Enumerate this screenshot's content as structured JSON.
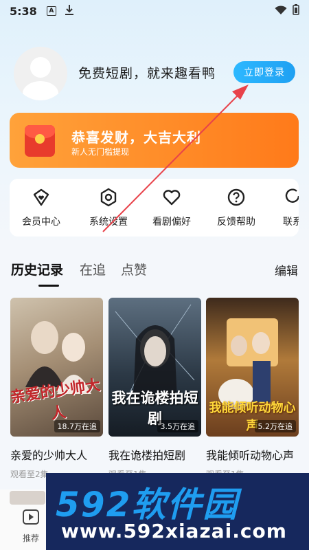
{
  "status_bar": {
    "time": "5:38",
    "a_icon": "A"
  },
  "profile": {
    "headline": "免费短剧，就来趣看鸭",
    "login_label": "立即登录"
  },
  "banner": {
    "title": "恭喜发财，大吉大利",
    "subtitle": "新人无门槛提现"
  },
  "menu": [
    {
      "label": "会员中心",
      "icon": "heart-shield-icon"
    },
    {
      "label": "系统设置",
      "icon": "hexagon-gear-icon"
    },
    {
      "label": "看剧偏好",
      "icon": "heart-icon"
    },
    {
      "label": "反馈帮助",
      "icon": "question-icon"
    },
    {
      "label": "联系",
      "icon": "contact-icon"
    }
  ],
  "tabs": {
    "history": "历史记录",
    "following": "在追",
    "liked": "点赞",
    "edit": "编辑"
  },
  "cards": [
    {
      "title": "亲爱的少帅大人",
      "poster_title": "亲爱的少帅大人",
      "count": "18.7万在追",
      "sub": "观看至2集"
    },
    {
      "title": "我在诡楼拍短剧",
      "poster_title": "我在诡楼拍短剧",
      "count": "3.5万在追",
      "sub": "观看至1集"
    },
    {
      "title": "我能倾听动物心声",
      "poster_title": "我能倾听动物心声",
      "count": "5.2万在追",
      "sub": "观看至1集"
    }
  ],
  "bottom_nav": {
    "recommend": "推荐"
  },
  "watermark": {
    "main": "592软件园",
    "sub": "www.592xiazai.com"
  },
  "colors": {
    "accent": "#1fa0f2",
    "banner": "#ff8a24",
    "arrow": "#e8424a"
  }
}
